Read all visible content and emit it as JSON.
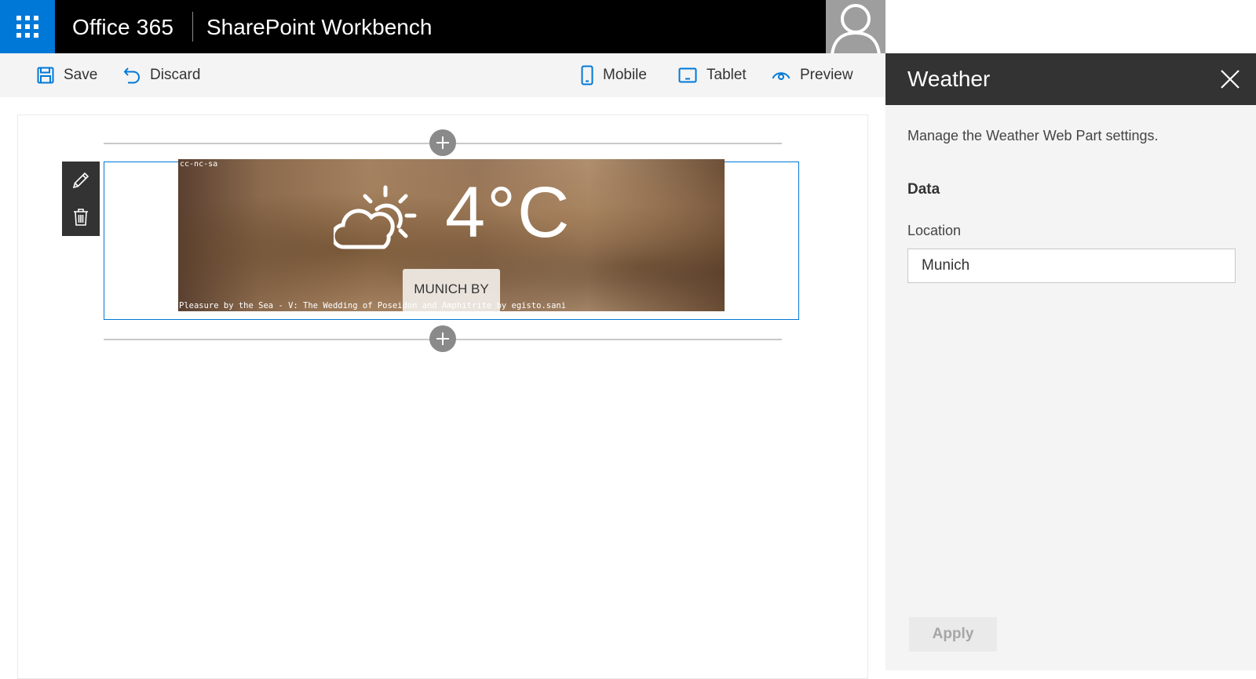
{
  "suitebar": {
    "brand": "Office 365",
    "app_name": "SharePoint Workbench",
    "colors": {
      "bar": "#000000",
      "waffle": "#0078d7"
    }
  },
  "commandbar": {
    "save_label": "Save",
    "discard_label": "Discard",
    "mobile_label": "Mobile",
    "tablet_label": "Tablet",
    "preview_label": "Preview"
  },
  "webpart": {
    "credit_top": "cc-nc-sa",
    "credit_bottom": "Pleasure by the Sea - V: The Wedding of Poseidon and Amphitrite by egisto.sani",
    "temperature": "4°C",
    "location_label": "MUNICH BY",
    "condition_icon": "partly-cloudy-icon",
    "accent_color": "#0078d7"
  },
  "pane": {
    "title": "Weather",
    "description": "Manage the Weather Web Part settings.",
    "group_name": "Data",
    "location_field_label": "Location",
    "location_field_value": "Munich",
    "apply_label": "Apply"
  }
}
